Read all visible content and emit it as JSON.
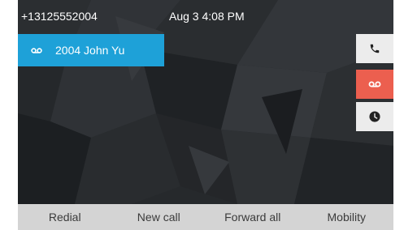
{
  "status_bar": {
    "number": "+13125552004",
    "datetime": "Aug 3 4:08 PM"
  },
  "line": {
    "label": "2004 John Yu",
    "icon": "voicemail-icon"
  },
  "side_buttons": [
    {
      "icon": "phone-icon",
      "active": false
    },
    {
      "icon": "voicemail-icon",
      "active": true
    },
    {
      "icon": "clock-icon",
      "active": false
    }
  ],
  "softkeys": [
    "Redial",
    "New call",
    "Forward all",
    "Mobility"
  ],
  "colors": {
    "line_accent": "#1ea1d8",
    "active_side_button": "#ec5f4f",
    "background": "#222528",
    "softkey_bar": "#d4d4d4"
  }
}
